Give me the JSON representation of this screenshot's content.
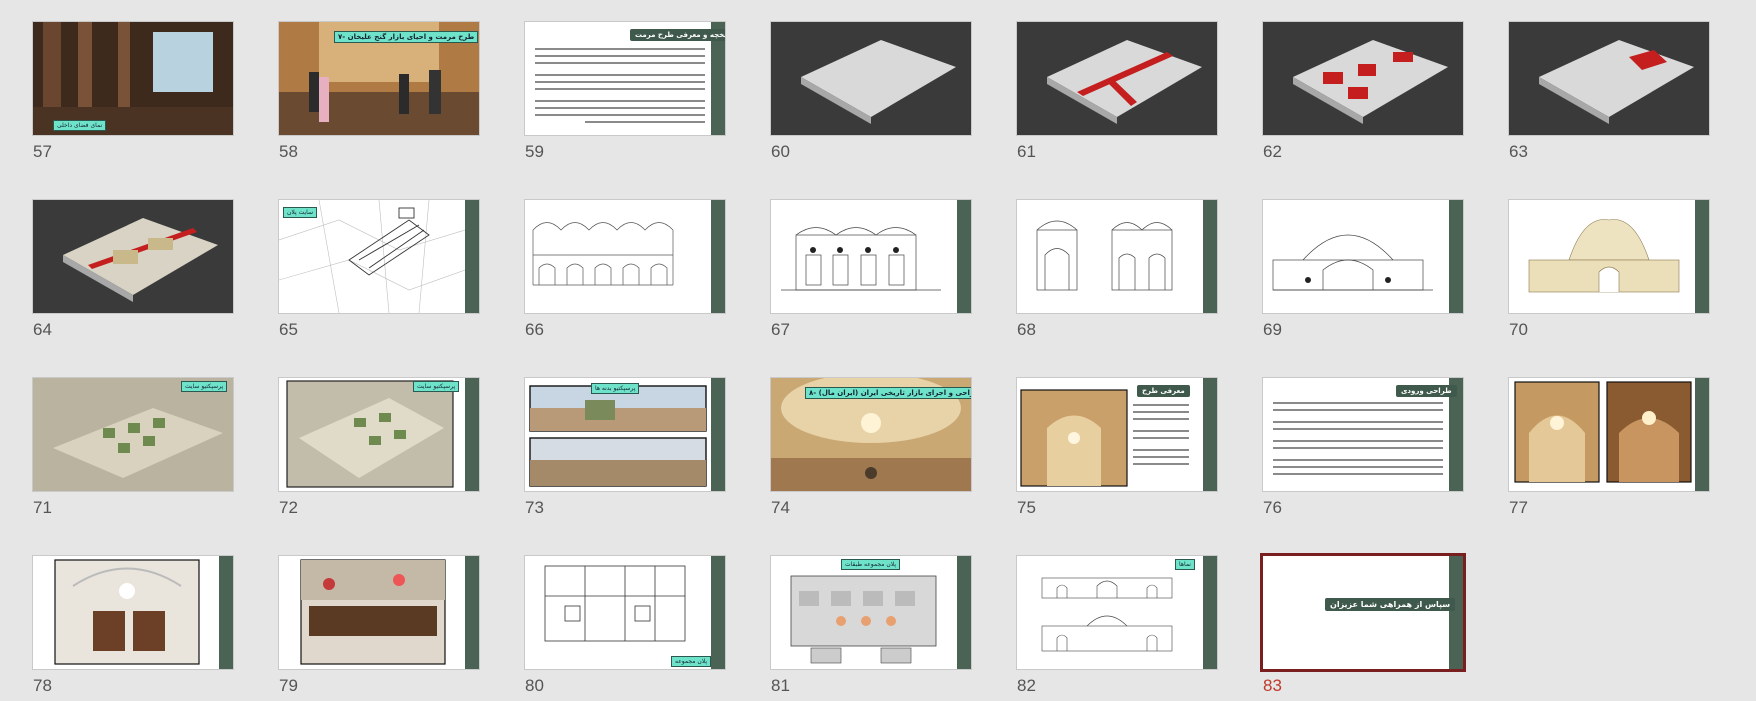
{
  "slides": [
    {
      "n": "57",
      "label": "نمای فضای داخلی"
    },
    {
      "n": "58",
      "title": "۷- طرح مرمت و احیای بازار گنج علیخان"
    },
    {
      "n": "59",
      "title": "تاریخچه و معرفی طرح مرمت"
    },
    {
      "n": "60"
    },
    {
      "n": "61"
    },
    {
      "n": "62"
    },
    {
      "n": "63"
    },
    {
      "n": "64"
    },
    {
      "n": "65",
      "label": "سایت پلان"
    },
    {
      "n": "66"
    },
    {
      "n": "67"
    },
    {
      "n": "68"
    },
    {
      "n": "69"
    },
    {
      "n": "70"
    },
    {
      "n": "71",
      "label": "پرسپکتیو سایت"
    },
    {
      "n": "72",
      "label": "پرسپکتیو سایت"
    },
    {
      "n": "73",
      "label": "پرسپکتیو بدنه ها"
    },
    {
      "n": "74",
      "title": "۸- طراحی و اجرای بازار تاریخی ایران (ایران مال)"
    },
    {
      "n": "75",
      "title": "معرفی طرح"
    },
    {
      "n": "76",
      "title": "طراحی ورودی"
    },
    {
      "n": "77"
    },
    {
      "n": "78"
    },
    {
      "n": "79"
    },
    {
      "n": "80",
      "label": "پلان مجموعه"
    },
    {
      "n": "81",
      "label": "پلان مجموعه طبقات"
    },
    {
      "n": "82",
      "label": "نماها"
    },
    {
      "n": "83",
      "title": "سپاس از همراهی شما عزیزان"
    }
  ],
  "selected": "83",
  "colors": {
    "accent": "#7a1f1f",
    "sidebar": "#4b6354",
    "label": "#6fe3c9"
  }
}
